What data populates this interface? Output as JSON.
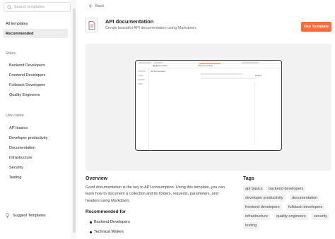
{
  "sidebar": {
    "search_placeholder": "Search templates",
    "all_templates": "All templates",
    "recommended": "Recommended",
    "roles": {
      "title": "Roles",
      "items": [
        "Backend Developers",
        "Frontend Developers",
        "Fullstack Developers",
        "Quality Engineers"
      ]
    },
    "use_cases": {
      "title": "Use cases",
      "items": [
        "API basics",
        "Developer productivity",
        "Documentation",
        "Infrastructure",
        "Security",
        "Testing"
      ]
    },
    "suggest": "Suggest Templates"
  },
  "header": {
    "back": "Back",
    "title": "API documentation",
    "description": "Create beautiful API documentation using Markdown.",
    "use_button": "Use Template"
  },
  "preview": {
    "collection_label": "API documentation",
    "tab_label": "API documentation",
    "side_label": "Request"
  },
  "overview": {
    "heading": "Overview",
    "text": "Good documentation is the key to API consumption. Using this template, you can learn how to document a collection and its folders, requests, parameters, and headers using Markdown."
  },
  "recommended_for": {
    "heading": "Recommended for",
    "items": [
      "Backend Developers",
      "Technical Writers"
    ]
  },
  "tags": {
    "heading": "Tags",
    "items": [
      "api basics",
      "backend developers",
      "developer productivity",
      "documentation",
      "frontend developers",
      "fullstack developers",
      "infrastructure",
      "quality engineers",
      "security",
      "testing"
    ]
  },
  "colors": {
    "accent": "#ff6c37",
    "sidebar_active": "#ededed",
    "preview_bg": "#f2f2f2",
    "tag_bg": "#f2f2f2"
  },
  "icons": {
    "search": "search-icon",
    "back": "arrow-left-icon",
    "template": "document-icon",
    "suggest": "lightbulb-icon"
  }
}
